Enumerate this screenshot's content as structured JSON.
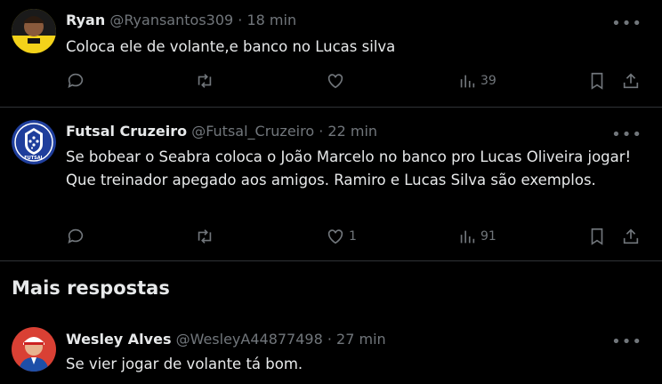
{
  "replies": [
    {
      "name": "Ryan",
      "handle": "@Ryansantos309",
      "time": "18 min",
      "text": "Coloca ele de volante,e banco no Lucas silva",
      "likes": "",
      "views": "39"
    },
    {
      "name": "Futsal Cruzeiro",
      "handle": "@Futsal_Cruzeiro",
      "time": "22 min",
      "text": "Se bobear o Seabra coloca o João Marcelo no banco pro Lucas Oliveira jogar! Que treinador apegado aos amigos. Ramiro e Lucas Silva são exemplos.",
      "likes": "1",
      "views": "91",
      "avatar_label": "FUTSAL"
    }
  ],
  "section": {
    "title": "Mais respostas"
  },
  "more_replies": [
    {
      "name": "Wesley Alves",
      "handle": "@WesleyA44877498",
      "time": "27 min",
      "text": "Se vier jogar de volante tá bom."
    }
  ],
  "ui": {
    "separator": "·",
    "more_glyph": "•••"
  },
  "colors": {
    "background": "#000000",
    "text": "#e7e9ea",
    "muted": "#71767b",
    "divider": "#2f3336",
    "cruzeiro_blue": "#1f3e9c"
  }
}
